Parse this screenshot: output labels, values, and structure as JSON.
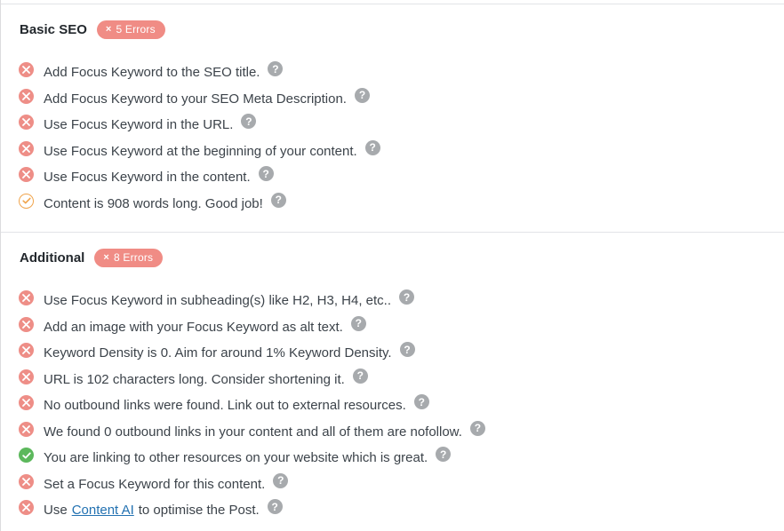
{
  "basic_seo": {
    "title": "Basic SEO",
    "badge": "5 Errors",
    "checks": [
      {
        "status": "fail",
        "text": "Add Focus Keyword to the SEO title."
      },
      {
        "status": "fail",
        "text": "Add Focus Keyword to your SEO Meta Description."
      },
      {
        "status": "fail",
        "text": "Use Focus Keyword in the URL."
      },
      {
        "status": "fail",
        "text": "Use Focus Keyword at the beginning of your content."
      },
      {
        "status": "fail",
        "text": "Use Focus Keyword in the content."
      },
      {
        "status": "warn",
        "text": "Content is 908 words long. Good job!"
      }
    ]
  },
  "additional": {
    "title": "Additional",
    "badge": "8 Errors",
    "checks": [
      {
        "status": "fail",
        "text": "Use Focus Keyword in subheading(s) like H2, H3, H4, etc.."
      },
      {
        "status": "fail",
        "text": "Add an image with your Focus Keyword as alt text."
      },
      {
        "status": "fail",
        "text": "Keyword Density is 0. Aim for around 1% Keyword Density."
      },
      {
        "status": "fail",
        "text": "URL is 102 characters long. Consider shortening it."
      },
      {
        "status": "fail",
        "text": "No outbound links were found. Link out to external resources."
      },
      {
        "status": "fail",
        "text": "We found 0 outbound links in your content and all of them are nofollow."
      },
      {
        "status": "pass",
        "text": "You are linking to other resources on your website which is great."
      },
      {
        "status": "fail",
        "text": "Set a Focus Keyword for this content."
      },
      {
        "status": "fail",
        "text_before": "Use",
        "link": "Content AI",
        "text_after": "to optimise the Post."
      }
    ]
  },
  "help_glyph": "?",
  "error_glyph": "×",
  "colors": {
    "fail": "#ee8e87",
    "pass": "#5cb85c",
    "warn": "#f0a44b",
    "badge": "#f08c85",
    "help": "#a7aaad",
    "link": "#2271b1"
  }
}
